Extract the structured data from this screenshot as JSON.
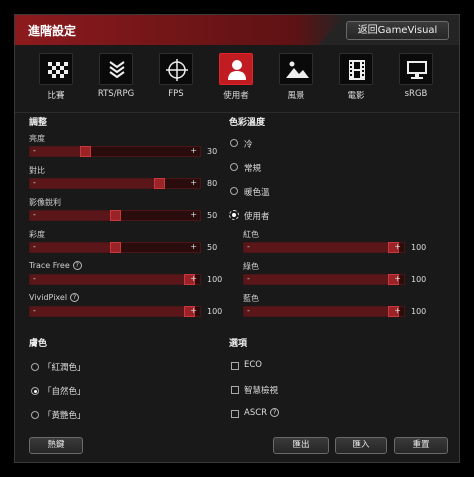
{
  "header": {
    "title": "進階設定",
    "back_label": "返回GameVisual"
  },
  "modes": [
    {
      "id": "racing",
      "label": "比賽",
      "icon": "checkered-flag-icon"
    },
    {
      "id": "rts",
      "label": "RTS/RPG",
      "icon": "rank-chevron-icon"
    },
    {
      "id": "fps",
      "label": "FPS",
      "icon": "crosshair-icon"
    },
    {
      "id": "user",
      "label": "使用者",
      "icon": "user-icon",
      "active": true
    },
    {
      "id": "scenery",
      "label": "風景",
      "icon": "mountain-icon"
    },
    {
      "id": "cinema",
      "label": "電影",
      "icon": "film-icon"
    },
    {
      "id": "srgb",
      "label": "sRGB",
      "icon": "monitor-icon"
    }
  ],
  "adjust": {
    "title": "調整",
    "sliders": [
      {
        "label": "亮度",
        "value": "30",
        "fraction": 0.3
      },
      {
        "label": "對比",
        "value": "80",
        "fraction": 0.8
      },
      {
        "label": "影像銳利",
        "value": "50",
        "fraction": 0.5
      },
      {
        "label": "彩度",
        "value": "50",
        "fraction": 0.5
      },
      {
        "label": "Trace Free",
        "value": "100",
        "fraction": 1.0,
        "help": "?"
      },
      {
        "label": "VividPixel",
        "value": "100",
        "fraction": 1.0,
        "help": "?"
      }
    ]
  },
  "color_temp": {
    "title": "色彩溫度",
    "options": [
      {
        "label": "冷",
        "selected": false
      },
      {
        "label": "常規",
        "selected": false
      },
      {
        "label": "暖色溫",
        "selected": false
      },
      {
        "label": "使用者",
        "selected": true
      }
    ],
    "sliders": [
      {
        "label": "紅色",
        "value": "100",
        "fraction": 1.0
      },
      {
        "label": "綠色",
        "value": "100",
        "fraction": 1.0
      },
      {
        "label": "藍色",
        "value": "100",
        "fraction": 1.0
      }
    ]
  },
  "skin": {
    "title": "膚色",
    "options": [
      {
        "label": "「紅潤色」",
        "selected": false
      },
      {
        "label": "「自然色」",
        "selected": true
      },
      {
        "label": "「黃艷色」",
        "selected": false
      }
    ]
  },
  "options": {
    "title": "選項",
    "items": [
      {
        "label": "ECO",
        "checked": false
      },
      {
        "label": "智慧檢視",
        "checked": false
      },
      {
        "label": "ASCR",
        "checked": false,
        "help": "?"
      }
    ]
  },
  "footer": {
    "hotkey": "熱鍵",
    "export": "匯出",
    "import": "匯入",
    "reset": "重置"
  }
}
